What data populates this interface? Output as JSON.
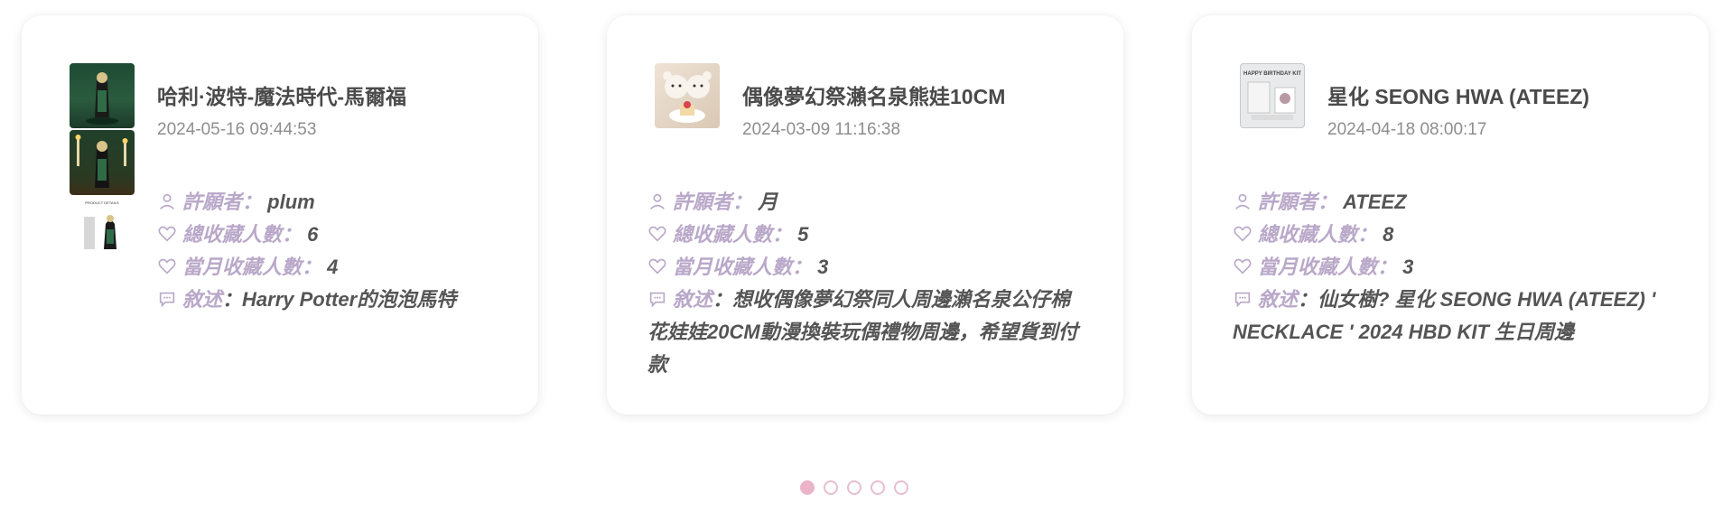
{
  "cards": [
    {
      "title": "哈利·波特-魔法時代-馬爾福",
      "date": "2024-05-16 09:44:53",
      "wisher_label": "許願者：",
      "wisher": "plum",
      "total_fav_label": "總收藏人數：",
      "total_fav": "6",
      "monthly_fav_label": "當月收藏人數：",
      "monthly_fav": "4",
      "desc_label": "敘述",
      "desc": "：Harry Potter的泡泡馬特",
      "thumb_text": "PRODUCT DETAILS"
    },
    {
      "title": "偶像夢幻祭瀨名泉熊娃10CM",
      "date": "2024-03-09 11:16:38",
      "wisher_label": "許願者：",
      "wisher": "月",
      "total_fav_label": "總收藏人數：",
      "total_fav": "5",
      "monthly_fav_label": "當月收藏人數：",
      "monthly_fav": "3",
      "desc_label": "敘述",
      "desc": "：想收偶像夢幻祭同人周邊瀨名泉公仔棉花娃娃20CM動漫換裝玩偶禮物周邊，希望貨到付款"
    },
    {
      "title": "星化 SEONG HWA (ATEEZ)",
      "date": "2024-04-18 08:00:17",
      "wisher_label": "許願者：",
      "wisher": "ATEEZ",
      "total_fav_label": "總收藏人數：",
      "total_fav": "8",
      "monthly_fav_label": "當月收藏人數：",
      "monthly_fav": "3",
      "desc_label": "敘述",
      "desc": "：仙女樹? 星化 SEONG HWA (ATEEZ) ' NECKLACE ' 2024 HBD KIT 生日周邊",
      "thumb_text": "HAPPY BIRTHDAY KIT"
    }
  ],
  "icons": {
    "user": "user-icon",
    "heart": "heart-icon",
    "comment": "comment-icon"
  },
  "colors": {
    "label": "#b9a8c9",
    "text": "#555555",
    "title": "#4a4a4a",
    "date": "#8e8e8e",
    "dot_active": "#ebb3c8",
    "dot_border": "#e6bfd0"
  },
  "pagination": {
    "pages": 5,
    "active": 1
  }
}
